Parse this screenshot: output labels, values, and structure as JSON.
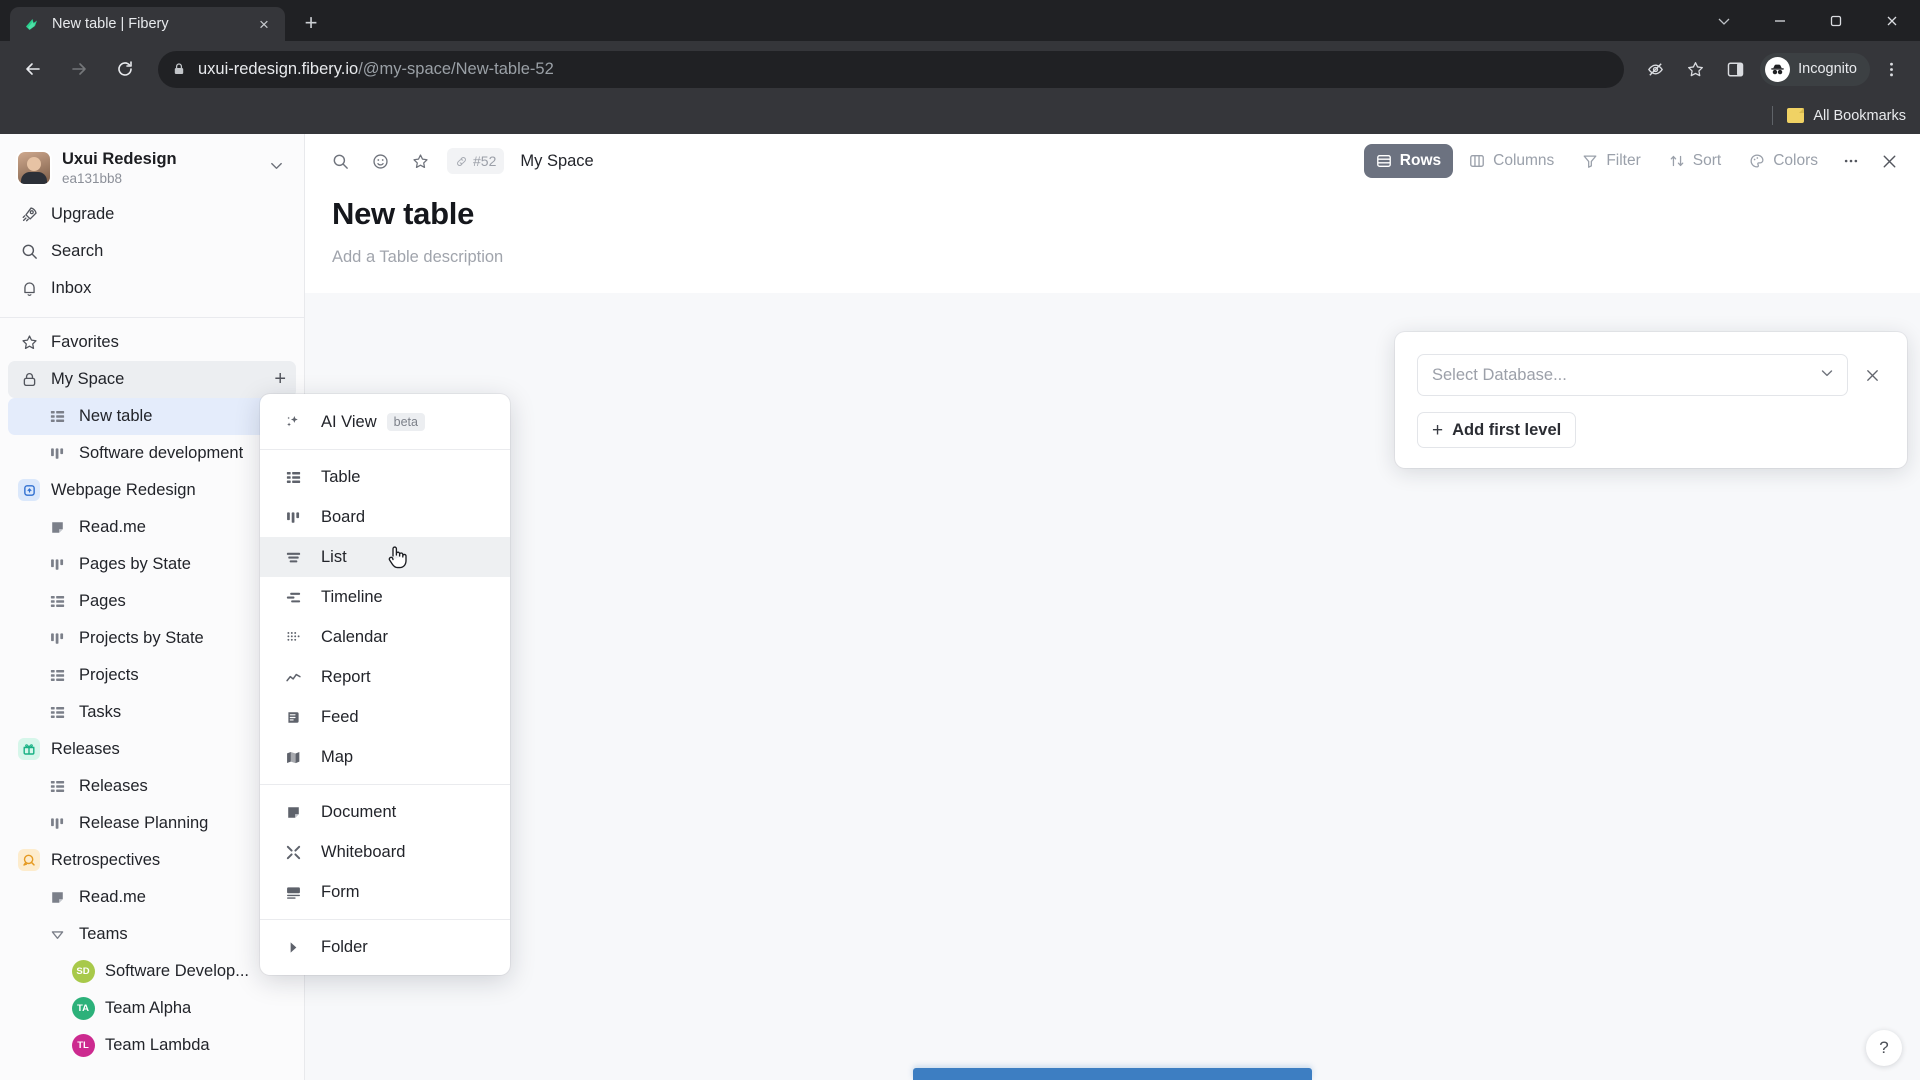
{
  "browser": {
    "tab": {
      "title": "New table | Fibery",
      "favicon": "fibery-leaf-icon",
      "close_label": "×"
    },
    "new_tab_label": "+",
    "window_controls": [
      "chevron-down",
      "minimize",
      "maximize",
      "close"
    ],
    "nav": {
      "back": "←",
      "forward": "→",
      "reload": "⟳"
    },
    "url": {
      "secure_icon": "lock-icon",
      "domain": "uxui-redesign.fibery.io",
      "path": "/@my-space/New-table-52"
    },
    "toolbar_icons": [
      "eye-slash-icon",
      "star-icon",
      "side-panel-icon",
      "kebab-menu-icon"
    ],
    "profile": {
      "label": "Incognito",
      "icon": "incognito-icon"
    },
    "bookmarks": {
      "label": "All Bookmarks",
      "icon": "folder-icon"
    }
  },
  "sidebar": {
    "workspace": {
      "name": "Uxui Redesign",
      "id": "ea131bb8",
      "chevron": "chevron-down-icon"
    },
    "nav": [
      {
        "label": "Upgrade",
        "icon": "rocket-icon"
      },
      {
        "label": "Search",
        "icon": "search-icon"
      },
      {
        "label": "Inbox",
        "icon": "bell-icon"
      }
    ],
    "tree": [
      {
        "label": "Favorites",
        "icon": "star-icon",
        "level": 0,
        "kind": "section"
      },
      {
        "label": "My Space",
        "icon": "lock-icon",
        "level": 0,
        "kind": "section",
        "active": true,
        "action": "+"
      },
      {
        "label": "New table",
        "icon": "table-icon",
        "level": 1,
        "kind": "view",
        "selected": true
      },
      {
        "label": "Software development",
        "icon": "board-icon",
        "level": 1,
        "kind": "view"
      },
      {
        "label": "Webpage Redesign",
        "icon": "space-blue-icon",
        "level": 0,
        "kind": "space"
      },
      {
        "label": "Read.me",
        "icon": "document-icon",
        "level": 1,
        "kind": "view"
      },
      {
        "label": "Pages by State",
        "icon": "board-icon",
        "level": 1,
        "kind": "view"
      },
      {
        "label": "Pages",
        "icon": "table-icon",
        "level": 1,
        "kind": "view"
      },
      {
        "label": "Projects by State",
        "icon": "board-icon",
        "level": 1,
        "kind": "view"
      },
      {
        "label": "Projects",
        "icon": "table-icon",
        "level": 1,
        "kind": "view"
      },
      {
        "label": "Tasks",
        "icon": "table-icon",
        "level": 1,
        "kind": "view"
      },
      {
        "label": "Releases",
        "icon": "gift-icon",
        "level": 0,
        "kind": "space"
      },
      {
        "label": "Releases",
        "icon": "table-icon",
        "level": 1,
        "kind": "view"
      },
      {
        "label": "Release Planning",
        "icon": "board-icon",
        "level": 1,
        "kind": "view"
      },
      {
        "label": "Retrospectives",
        "icon": "retro-icon",
        "level": 0,
        "kind": "space"
      },
      {
        "label": "Read.me",
        "icon": "document-icon",
        "level": 1,
        "kind": "view"
      },
      {
        "label": "Teams",
        "icon": "chevron-collapse-icon",
        "level": 1,
        "kind": "group"
      },
      {
        "label": "Software Develop...",
        "icon": "avatar-sd",
        "level": 2,
        "kind": "team",
        "initials": "SD",
        "color": "#a8c94a"
      },
      {
        "label": "Team Alpha",
        "icon": "avatar-ta",
        "level": 2,
        "kind": "team",
        "initials": "TA",
        "color": "#2cb17a"
      },
      {
        "label": "Team Lambda",
        "icon": "avatar-tl",
        "level": 2,
        "kind": "team",
        "initials": "TL",
        "color": "#cc2a8f"
      }
    ]
  },
  "header": {
    "left_icons": [
      "search-icon",
      "emoji-icon",
      "star-icon"
    ],
    "entity_id": "#52",
    "entity_id_icon": "link-icon",
    "breadcrumb": "My Space",
    "tools": [
      {
        "label": "Rows",
        "icon": "rows-icon",
        "active": true
      },
      {
        "label": "Columns",
        "icon": "columns-icon",
        "active": false
      },
      {
        "label": "Filter",
        "icon": "filter-icon",
        "active": false
      },
      {
        "label": "Sort",
        "icon": "sort-icon",
        "active": false
      },
      {
        "label": "Colors",
        "icon": "palette-icon",
        "active": false
      }
    ],
    "more_label": "•••",
    "close_label": "×"
  },
  "page": {
    "title": "New table",
    "description_placeholder": "Add a Table description"
  },
  "rows_popover": {
    "database_placeholder": "Select Database...",
    "dropdown_icon": "chevron-down-icon",
    "remove_icon": "close-icon",
    "add_level_label": "Add first level",
    "add_level_plus": "+"
  },
  "view_menu": {
    "groups": [
      [
        {
          "label": "AI View",
          "icon": "sparkle-icon",
          "badge": "beta"
        }
      ],
      [
        {
          "label": "Table",
          "icon": "table-icon"
        },
        {
          "label": "Board",
          "icon": "board-icon"
        },
        {
          "label": "List",
          "icon": "list-icon",
          "highlighted": true
        },
        {
          "label": "Timeline",
          "icon": "timeline-icon"
        },
        {
          "label": "Calendar",
          "icon": "calendar-icon"
        },
        {
          "label": "Report",
          "icon": "report-icon"
        },
        {
          "label": "Feed",
          "icon": "feed-icon"
        },
        {
          "label": "Map",
          "icon": "map-icon"
        }
      ],
      [
        {
          "label": "Document",
          "icon": "document-icon"
        },
        {
          "label": "Whiteboard",
          "icon": "whiteboard-icon"
        },
        {
          "label": "Form",
          "icon": "form-icon"
        }
      ],
      [
        {
          "label": "Folder",
          "icon": "folder-triangle-icon"
        }
      ]
    ]
  },
  "help": {
    "label": "?"
  },
  "colors": {
    "accent_blue": "#3d7ec2",
    "selection_blue": "#e4ecfb",
    "active_toolbar": "#6c7280",
    "fibery_green": "#2ad18f"
  }
}
